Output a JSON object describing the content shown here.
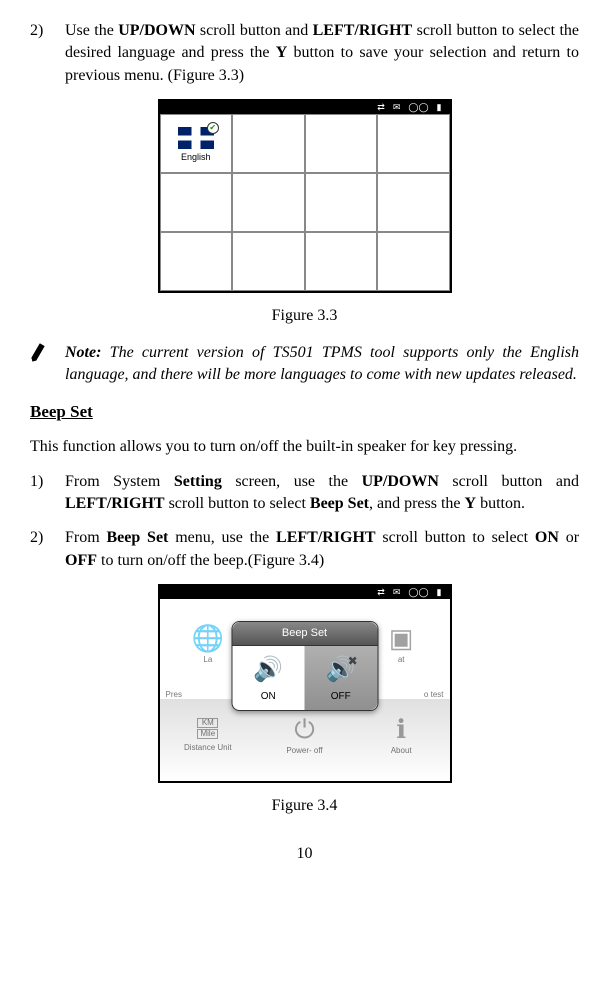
{
  "step2": {
    "num": "2)",
    "t1": "Use the ",
    "b1": "UP/DOWN",
    "t2": " scroll button and ",
    "b2": "LEFT/RIGHT",
    "t3": " scroll button to select the desired language and press the ",
    "b3": "Y",
    "t4": " button to save your selection and return to previous menu. (Figure 3.3)"
  },
  "fig33": {
    "lang_label": "English",
    "caption": "Figure 3.3"
  },
  "note": {
    "label": "Note:",
    "text": " The current version of TS501 TPMS tool supports only the English language, and there will be more languages to come with new updates released."
  },
  "beep_heading": "Beep Set",
  "beep_para": "This function allows you to turn on/off the built-in speaker for key pressing.",
  "bstep1": {
    "num": "1)",
    "t1": "From System ",
    "b1": "Setting",
    "t2": " screen, use the ",
    "b2": "UP/DOWN",
    "t3": " scroll button and ",
    "b3": "LEFT/RIGHT",
    "t4": " scroll button to select ",
    "b4": "Beep Set",
    "t5": ", and press the ",
    "b5": "Y",
    "t6": " button."
  },
  "bstep2": {
    "num": "2)",
    "t1": "From ",
    "b1": "Beep Set",
    "t2": " menu, use the ",
    "b2": "LEFT/RIGHT",
    "t3": " scroll button to select ",
    "b3": "ON",
    "t4": " or ",
    "b4": "OFF",
    "t5": " to turn on/off the beep.(Figure 3.4)"
  },
  "fig34": {
    "popup_title": "Beep Set",
    "on_label": "ON",
    "off_label": "OFF",
    "caption": "Figure 3.4",
    "bg": {
      "c1": "La",
      "c2": "",
      "c3": "at",
      "c4_top": "KM",
      "c4_bot": "Mile",
      "c4": "Distance Unit",
      "c5": "Power- off",
      "c6": "About",
      "pres": "Pres",
      "test": "o test"
    }
  },
  "page_num": "10"
}
